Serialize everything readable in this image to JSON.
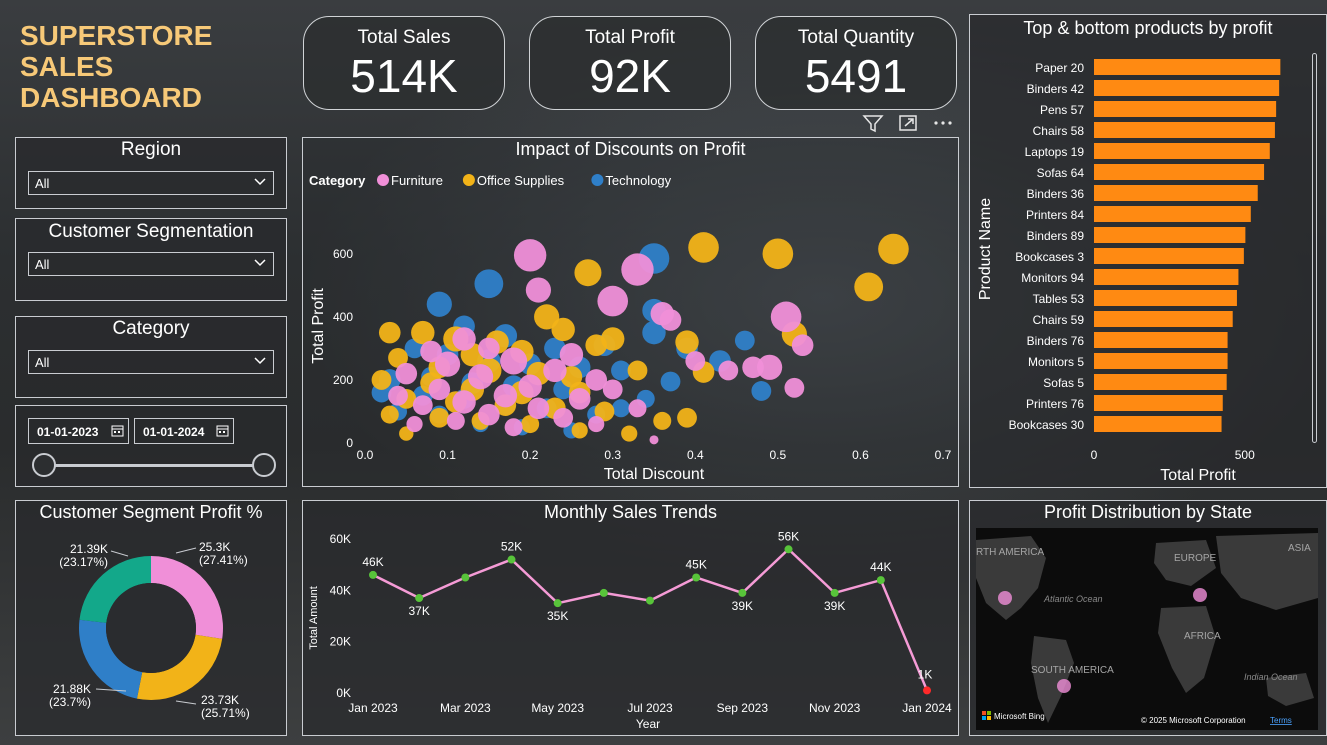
{
  "dashboard_title": "SUPERSTORE SALES DASHBOARD",
  "kpis": [
    {
      "label": "Total Sales",
      "value": "514K"
    },
    {
      "label": "Total Profit",
      "value": "92K"
    },
    {
      "label": "Total Quantity",
      "value": "5491"
    }
  ],
  "slicers": {
    "region": {
      "title": "Region",
      "value": "All"
    },
    "segment": {
      "title": "Customer Segmentation",
      "value": "All"
    },
    "category": {
      "title": "Category",
      "value": "All"
    },
    "date_start": "01-01-2023",
    "date_end": "01-01-2024"
  },
  "colors": {
    "furniture": "#f08fd8",
    "office": "#f2b318",
    "technology": "#2f7fc8",
    "bar": "#ff8a12",
    "line": "#f59bd6",
    "point": "#58c43a",
    "last_point": "#ff2a2a",
    "title_gold": "#f7c978"
  },
  "chart_data": [
    {
      "id": "scatter",
      "type": "scatter",
      "title": "Impact of Discounts on Profit",
      "xlabel": "Total Discount",
      "ylabel": "Total Profit",
      "legend_title": "Category",
      "legend_position": "top-left",
      "xlim": [
        0,
        0.7
      ],
      "ylim": [
        0,
        650
      ],
      "xticks": [
        "0.0",
        "0.1",
        "0.2",
        "0.3",
        "0.4",
        "0.5",
        "0.6",
        "0.7"
      ],
      "yticks": [
        "0",
        "200",
        "400",
        "600"
      ],
      "series": [
        {
          "name": "Furniture",
          "points": [
            [
              0.2,
              595,
              18
            ],
            [
              0.33,
              550,
              18
            ],
            [
              0.21,
              485,
              14
            ],
            [
              0.3,
              450,
              17
            ],
            [
              0.36,
              410,
              13
            ],
            [
              0.51,
              400,
              17
            ],
            [
              0.53,
              310,
              12
            ],
            [
              0.49,
              240,
              14
            ],
            [
              0.52,
              175,
              11
            ],
            [
              0.12,
              330,
              13
            ],
            [
              0.15,
              300,
              12
            ],
            [
              0.25,
              280,
              13
            ],
            [
              0.08,
              290,
              12
            ],
            [
              0.1,
              250,
              14
            ],
            [
              0.18,
              260,
              15
            ],
            [
              0.23,
              230,
              13
            ],
            [
              0.05,
              220,
              12
            ],
            [
              0.14,
              210,
              14
            ],
            [
              0.28,
              200,
              12
            ],
            [
              0.2,
              180,
              13
            ],
            [
              0.09,
              170,
              12
            ],
            [
              0.17,
              150,
              13
            ],
            [
              0.26,
              140,
              12
            ],
            [
              0.3,
              170,
              11
            ],
            [
              0.12,
              130,
              13
            ],
            [
              0.07,
              120,
              11
            ],
            [
              0.21,
              110,
              12
            ],
            [
              0.33,
              110,
              10
            ],
            [
              0.04,
              150,
              11
            ],
            [
              0.15,
              90,
              12
            ],
            [
              0.24,
              80,
              11
            ],
            [
              0.11,
              70,
              10
            ],
            [
              0.18,
              50,
              10
            ],
            [
              0.28,
              60,
              9
            ],
            [
              0.06,
              60,
              9
            ],
            [
              0.35,
              10,
              5
            ],
            [
              0.37,
              390,
              12
            ],
            [
              0.4,
              260,
              11
            ],
            [
              0.44,
              230,
              11
            ],
            [
              0.47,
              240,
              12
            ]
          ]
        },
        {
          "name": "Office Supplies",
          "points": [
            [
              0.41,
              620,
              17
            ],
            [
              0.5,
              600,
              17
            ],
            [
              0.64,
              615,
              17
            ],
            [
              0.61,
              495,
              16
            ],
            [
              0.27,
              540,
              15
            ],
            [
              0.52,
              345,
              14
            ],
            [
              0.39,
              320,
              13
            ],
            [
              0.3,
              330,
              13
            ],
            [
              0.41,
              225,
              12
            ],
            [
              0.33,
              230,
              11
            ],
            [
              0.39,
              80,
              11
            ],
            [
              0.03,
              350,
              12
            ],
            [
              0.07,
              350,
              13
            ],
            [
              0.11,
              330,
              14
            ],
            [
              0.16,
              320,
              13
            ],
            [
              0.22,
              400,
              14
            ],
            [
              0.24,
              360,
              13
            ],
            [
              0.28,
              310,
              12
            ],
            [
              0.13,
              280,
              13
            ],
            [
              0.19,
              290,
              13
            ],
            [
              0.04,
              270,
              11
            ],
            [
              0.09,
              240,
              12
            ],
            [
              0.15,
              230,
              14
            ],
            [
              0.21,
              220,
              13
            ],
            [
              0.25,
              210,
              12
            ],
            [
              0.02,
              200,
              11
            ],
            [
              0.08,
              190,
              12
            ],
            [
              0.13,
              170,
              13
            ],
            [
              0.19,
              160,
              13
            ],
            [
              0.26,
              160,
              12
            ],
            [
              0.05,
              140,
              11
            ],
            [
              0.11,
              130,
              12
            ],
            [
              0.17,
              120,
              12
            ],
            [
              0.23,
              110,
              12
            ],
            [
              0.29,
              100,
              11
            ],
            [
              0.03,
              90,
              10
            ],
            [
              0.09,
              80,
              11
            ],
            [
              0.14,
              70,
              10
            ],
            [
              0.2,
              60,
              10
            ],
            [
              0.26,
              40,
              9
            ],
            [
              0.32,
              30,
              9
            ],
            [
              0.05,
              30,
              8
            ],
            [
              0.36,
              70,
              10
            ]
          ]
        },
        {
          "name": "Technology",
          "points": [
            [
              0.35,
              585,
              17
            ],
            [
              0.15,
              505,
              16
            ],
            [
              0.09,
              440,
              14
            ],
            [
              0.35,
              420,
              13
            ],
            [
              0.35,
              350,
              13
            ],
            [
              0.39,
              300,
              12
            ],
            [
              0.46,
              325,
              11
            ],
            [
              0.43,
              260,
              12
            ],
            [
              0.48,
              165,
              11
            ],
            [
              0.37,
              195,
              11
            ],
            [
              0.12,
              370,
              12
            ],
            [
              0.17,
              340,
              13
            ],
            [
              0.23,
              300,
              12
            ],
            [
              0.29,
              310,
              12
            ],
            [
              0.06,
              300,
              11
            ],
            [
              0.1,
              280,
              12
            ],
            [
              0.15,
              260,
              13
            ],
            [
              0.2,
              250,
              12
            ],
            [
              0.26,
              240,
              12
            ],
            [
              0.31,
              230,
              11
            ],
            [
              0.03,
              200,
              12
            ],
            [
              0.08,
              210,
              11
            ],
            [
              0.13,
              190,
              12
            ],
            [
              0.18,
              180,
              12
            ],
            [
              0.24,
              170,
              11
            ],
            [
              0.02,
              160,
              11
            ],
            [
              0.07,
              150,
              11
            ],
            [
              0.12,
              140,
              11
            ],
            [
              0.17,
              120,
              11
            ],
            [
              0.22,
              110,
              11
            ],
            [
              0.28,
              90,
              10
            ],
            [
              0.04,
              100,
              10
            ],
            [
              0.09,
              90,
              10
            ],
            [
              0.14,
              60,
              9
            ],
            [
              0.19,
              50,
              9
            ],
            [
              0.25,
              40,
              9
            ],
            [
              0.31,
              110,
              10
            ],
            [
              0.34,
              140,
              10
            ]
          ]
        }
      ]
    },
    {
      "id": "topbottom",
      "type": "bar",
      "orientation": "horizontal",
      "title": "Top & bottom products by profit",
      "xlabel": "Total Profit",
      "ylabel": "Product Name",
      "xlim": [
        0,
        650
      ],
      "xticks": [
        "0",
        "500"
      ],
      "categories": [
        "Paper 20",
        "Binders 42",
        "Pens 57",
        "Chairs 58",
        "Laptops 19",
        "Sofas 64",
        "Binders 36",
        "Printers 84",
        "Binders 89",
        "Bookcases 3",
        "Monitors 94",
        "Tables 53",
        "Chairs 59",
        "Binders 76",
        "Monitors 5",
        "Sofas 5",
        "Printers 76",
        "Bookcases 30"
      ],
      "values": [
        618,
        614,
        604,
        600,
        583,
        564,
        543,
        520,
        502,
        497,
        479,
        474,
        460,
        443,
        443,
        440,
        427,
        423
      ]
    },
    {
      "id": "donut",
      "type": "pie",
      "title": "Customer Segment Profit %",
      "slices": [
        {
          "label": "25.3K",
          "pct_label": "(27.41%)",
          "value": 27.41,
          "color": "#f08fd8"
        },
        {
          "label": "23.73K",
          "pct_label": "(25.71%)",
          "value": 25.71,
          "color": "#f2b318"
        },
        {
          "label": "21.88K",
          "pct_label": "(23.7%)",
          "value": 23.7,
          "color": "#2f7fc8"
        },
        {
          "label": "21.39K",
          "pct_label": "(23.17%)",
          "value": 23.17,
          "color": "#13a88a"
        }
      ]
    },
    {
      "id": "trend",
      "type": "line",
      "title": "Monthly Sales Trends",
      "xlabel": "Year",
      "ylabel": "Total Amount",
      "ylim": [
        0,
        60000
      ],
      "yticks": [
        "0K",
        "20K",
        "40K",
        "60K"
      ],
      "xticks": [
        "Jan 2023",
        "Mar 2023",
        "May 2023",
        "Jul 2023",
        "Sep 2023",
        "Nov 2023",
        "Jan 2024"
      ],
      "x": [
        "Jan 2023",
        "Feb 2023",
        "Mar 2023",
        "Apr 2023",
        "May 2023",
        "Jun 2023",
        "Jul 2023",
        "Aug 2023",
        "Sep 2023",
        "Oct 2023",
        "Nov 2023",
        "Dec 2023",
        "Jan 2024"
      ],
      "values": [
        46000,
        37000,
        45000,
        52000,
        35000,
        39000,
        36000,
        45000,
        39000,
        56000,
        39000,
        44000,
        1000
      ],
      "labels": [
        "46K",
        "37K",
        "",
        "52K",
        "35K",
        "",
        "",
        "45K",
        "39K",
        "56K",
        "39K",
        "44K",
        "1K"
      ]
    }
  ],
  "map": {
    "title": "Profit Distribution by State",
    "labels": [
      "RTH AMERICA",
      "EUROPE",
      "ASIA",
      "Atlantic Ocean",
      "AFRICA",
      "SOUTH AMERICA",
      "Indian Ocean"
    ],
    "brand": "Microsoft Bing",
    "copyright": "© 2025 Microsoft Corporation",
    "terms": "Terms"
  }
}
